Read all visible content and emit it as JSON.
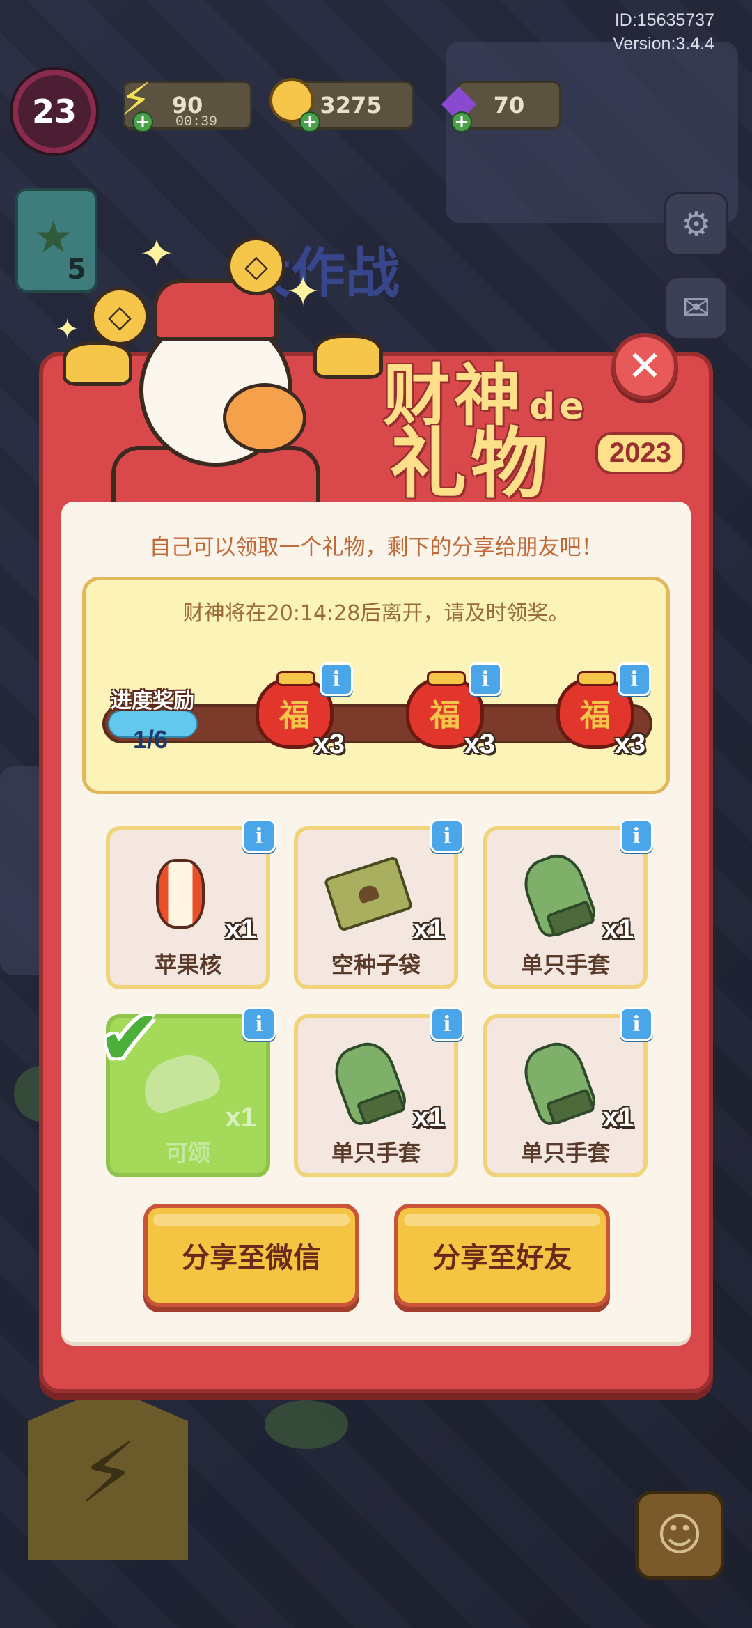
{
  "header": {
    "user_id": "ID:15635737",
    "version": "Version:3.4.4"
  },
  "resources": {
    "level": "23",
    "energy": "90",
    "energy_timer": "00:39",
    "coins": "3275",
    "gems": "70"
  },
  "sidebar": {
    "task_count": "5"
  },
  "modal": {
    "title_line1": "财神",
    "title_de": "de",
    "title_line2": "礼物",
    "year": "2023",
    "subtitle": "自己可以领取一个礼物，剩下的分享给朋友吧！",
    "timer_text": "财神将在20:14:28后离开，请及时领奖。",
    "progress_label": "进度奖励",
    "progress_count": "1/6",
    "progress_fraction": 0.1667,
    "milestone_rewards": [
      {
        "icon": "fu-lucky-bag-icon",
        "glyph": "福",
        "qty": "x3"
      },
      {
        "icon": "fu-lucky-bag-icon",
        "glyph": "福",
        "qty": "x3"
      },
      {
        "icon": "fu-lucky-bag-icon",
        "glyph": "福",
        "qty": "x3"
      }
    ],
    "items": [
      {
        "label": "苹果核",
        "qty": "x1",
        "icon": "apple-core-icon",
        "claimed": false
      },
      {
        "label": "空种子袋",
        "qty": "x1",
        "icon": "empty-seed-bag-icon",
        "claimed": false
      },
      {
        "label": "单只手套",
        "qty": "x1",
        "icon": "single-glove-icon",
        "claimed": false
      },
      {
        "label": "可颂",
        "qty": "x1",
        "icon": "croissant-icon",
        "claimed": true
      },
      {
        "label": "单只手套",
        "qty": "x1",
        "icon": "single-glove-icon",
        "claimed": false
      },
      {
        "label": "单只手套",
        "qty": "x1",
        "icon": "single-glove-icon",
        "claimed": false
      }
    ],
    "share_wechat": "分享至微信",
    "share_friends": "分享至好友",
    "close_glyph": "✕",
    "info_glyph": "i",
    "check_glyph": "✔"
  },
  "background": {
    "event_title": "大作战"
  },
  "colors": {
    "modal_red": "#d9484a",
    "paper": "#fbf4ea",
    "button_yellow": "#f4c542",
    "progress_fill": "#63c8ee",
    "claimed_green": "#a5d95a"
  }
}
